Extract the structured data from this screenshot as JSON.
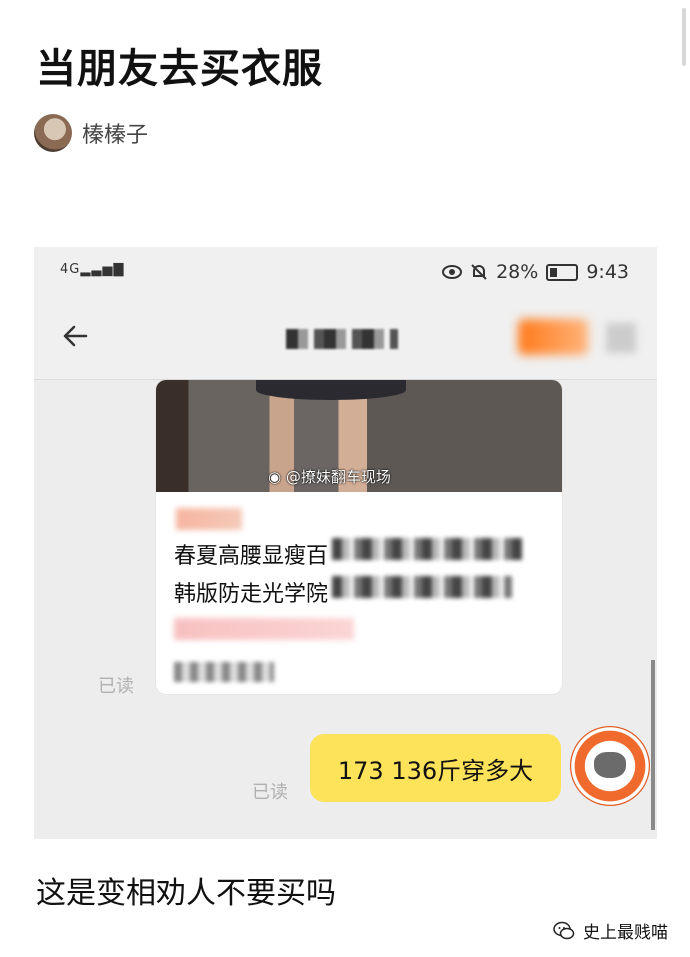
{
  "article": {
    "title": "当朋友去买衣服",
    "author": "榛榛子",
    "caption": "这是变相劝人不要买吗"
  },
  "screenshot": {
    "status_bar": {
      "signal": "4G",
      "battery": "28%",
      "time": "9:43"
    },
    "product_card": {
      "watermark": "@撩妹翻车现场",
      "line1": "春夏高腰显瘦百",
      "line2": "韩版防走光学院"
    },
    "read_label_1": "已读",
    "read_label_2": "已读",
    "my_message": "173 136斤穿多大"
  },
  "footer": {
    "source": "史上最贱喵"
  },
  "colors": {
    "bubble": "#fde35a",
    "chat_bg": "#ededed",
    "accent": "#ef6a2c"
  }
}
